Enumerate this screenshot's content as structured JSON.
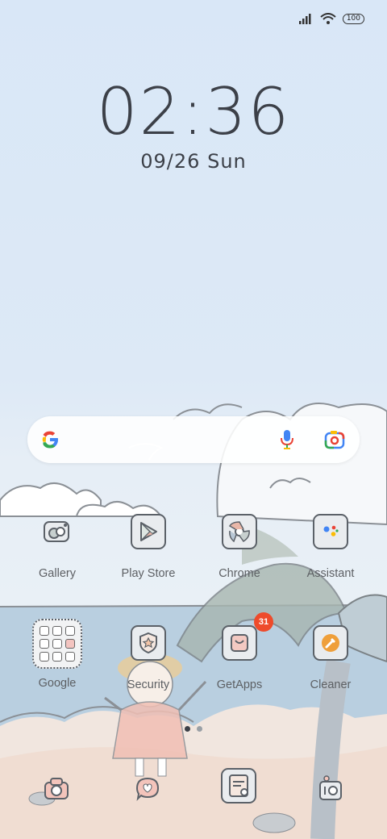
{
  "status_bar": {
    "battery": "100"
  },
  "lockscreen": {
    "time": "02:36",
    "date": "09/26",
    "day": "Sun"
  },
  "search_bar": {
    "google_logo": "G"
  },
  "apps_row1": [
    {
      "label": "Gallery"
    },
    {
      "label": "Play Store"
    },
    {
      "label": "Chrome"
    },
    {
      "label": "Assistant"
    }
  ],
  "apps_row2": [
    {
      "label": "Google"
    },
    {
      "label": "Security"
    },
    {
      "label": "GetApps",
      "badge": "31"
    },
    {
      "label": "Cleaner"
    }
  ],
  "page_indicator": {
    "pages": 2,
    "active": 0
  },
  "dock": [
    {
      "icon": "camera-icon"
    },
    {
      "icon": "messages-icon"
    },
    {
      "icon": "notes-icon"
    },
    {
      "icon": "photo-camera-icon"
    }
  ]
}
